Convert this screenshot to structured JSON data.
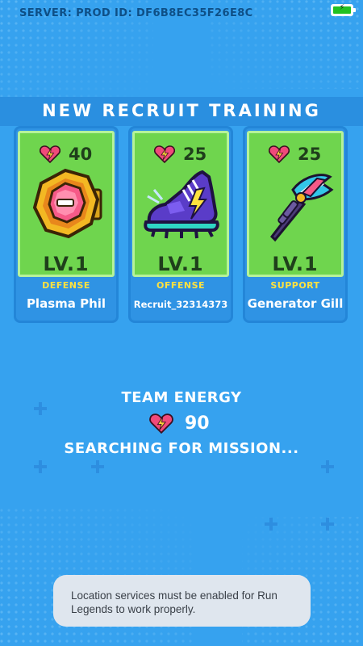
{
  "status_bar": {
    "server_text": "SERVER: PROD ID: DF6B8EC35F26E8C",
    "battery_icon": "battery-charging-icon"
  },
  "banner": {
    "title": "NEW RECRUIT TRAINING"
  },
  "cards": [
    {
      "stat": "40",
      "stat_icon": "heart-bolt-icon",
      "item_icon": "gem-shield-icon",
      "level": "LV.1",
      "role": "DEFENSE",
      "name": "Plasma Phil"
    },
    {
      "stat": "25",
      "stat_icon": "heart-bolt-icon",
      "item_icon": "spiked-sneaker-icon",
      "level": "LV.1",
      "role": "OFFENSE",
      "name": "Recruit_32314373"
    },
    {
      "stat": "25",
      "stat_icon": "heart-bolt-icon",
      "item_icon": "axe-wand-icon",
      "level": "LV.1",
      "role": "SUPPORT",
      "name": "Generator Gill"
    }
  ],
  "team": {
    "label": "TEAM ENERGY",
    "value": "90",
    "status": "SEARCHING FOR MISSION..."
  },
  "toast": {
    "message": "Location services must be enabled for Run Legends to work properly."
  },
  "colors": {
    "background": "#36a2ef",
    "card_green": "#6fd54e",
    "role_yellow": "#ffe23f",
    "heart_pink": "#f04a7a"
  }
}
